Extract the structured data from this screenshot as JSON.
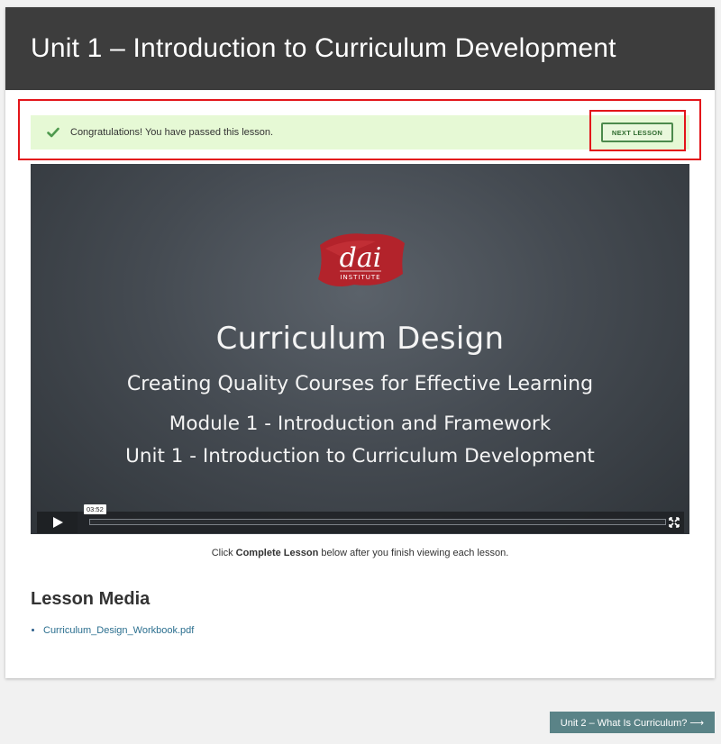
{
  "header": {
    "title": "Unit 1 – Introduction to Curriculum Development"
  },
  "alert": {
    "message": "Congratulations! You have passed this lesson.",
    "button_label": "NEXT LESSON",
    "color": "#e6f9d5"
  },
  "video": {
    "logo_text": "dai",
    "logo_subtext": "INSTITUTE",
    "title": "Curriculum Design",
    "subtitle": "Creating Quality Courses for Effective Learning",
    "module_line": "Module 1 - Introduction and Framework",
    "unit_line": "Unit 1 - Introduction to Curriculum Development",
    "duration": "03:52",
    "controls": {
      "play_icon": "play-icon",
      "fullscreen_icon": "fullscreen-icon"
    }
  },
  "hint": {
    "prefix": "Click ",
    "bold": "Complete Lesson",
    "suffix": " below after you finish viewing each lesson."
  },
  "lesson_media": {
    "heading": "Lesson Media",
    "files": [
      "Curriculum_Design_Workbook.pdf"
    ]
  },
  "navigation": {
    "next_unit_label": "Unit 2 – What Is Curriculum? ⟶"
  },
  "colors": {
    "header_bg": "#3d3d3d",
    "highlight_border": "#e3151a",
    "next_unit_button": "#5a8387",
    "logo_red": "#b3232b"
  }
}
